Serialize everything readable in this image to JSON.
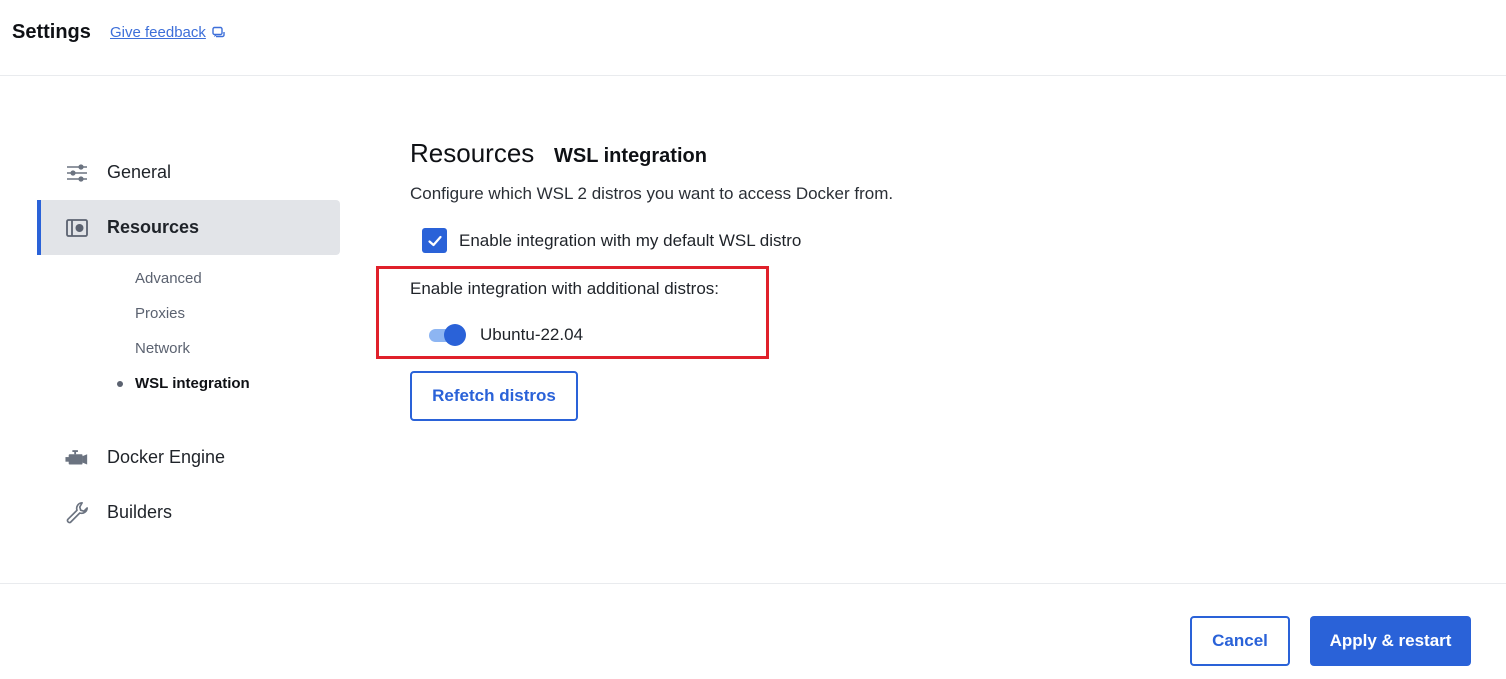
{
  "header": {
    "title": "Settings",
    "feedback_label": "Give feedback",
    "feedback_icon": "feedback-icon"
  },
  "sidebar": {
    "items": [
      {
        "label": "General",
        "icon": "sliders-icon",
        "active": false
      },
      {
        "label": "Resources",
        "icon": "resources-icon",
        "active": true
      },
      {
        "label": "Docker Engine",
        "icon": "engine-icon",
        "active": false
      },
      {
        "label": "Builders",
        "icon": "wrench-icon",
        "active": false
      }
    ],
    "resources_subitems": [
      {
        "label": "Advanced",
        "active": false
      },
      {
        "label": "Proxies",
        "active": false
      },
      {
        "label": "Network",
        "active": false
      },
      {
        "label": "WSL integration",
        "active": true
      }
    ]
  },
  "main": {
    "title": "Resources",
    "subtitle": "WSL integration",
    "description": "Configure which WSL 2 distros you want to access Docker from.",
    "default_distro_checkbox": {
      "label": "Enable integration with my default WSL distro",
      "checked": true
    },
    "additional_label": "Enable integration with additional distros:",
    "distros": [
      {
        "name": "Ubuntu-22.04",
        "enabled": true
      }
    ],
    "refetch_label": "Refetch distros"
  },
  "footer": {
    "cancel_label": "Cancel",
    "apply_label": "Apply & restart"
  },
  "colors": {
    "accent": "#2a62d8",
    "highlight": "#e0202a",
    "toggle_track": "#8db5f2",
    "active_nav_bg": "#e2e4e8"
  }
}
